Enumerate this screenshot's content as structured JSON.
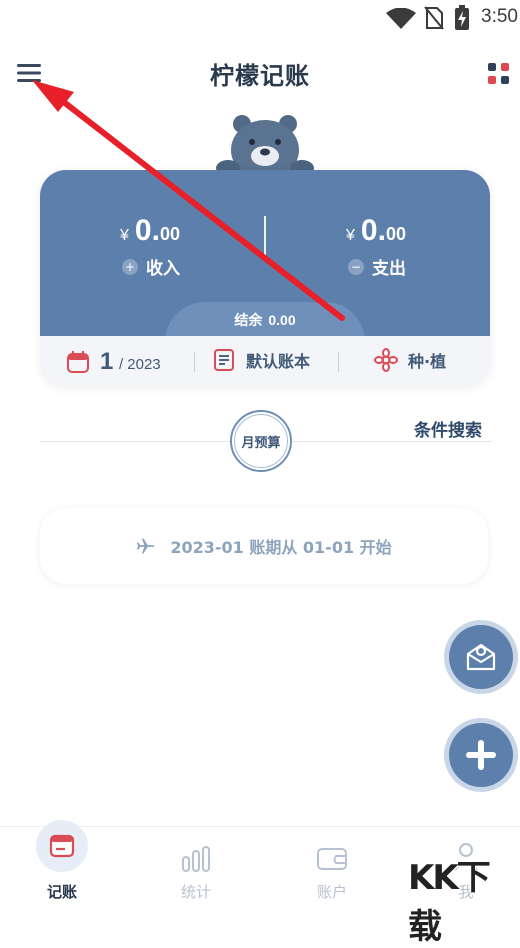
{
  "status_bar": {
    "time": "3:50"
  },
  "header": {
    "title": "柠檬记账"
  },
  "summary_card": {
    "currency": "¥",
    "income_int": "0.",
    "income_dec": "00",
    "income_label": "收入",
    "expense_int": "0.",
    "expense_dec": "00",
    "expense_label": "支出",
    "balance_label": "结余",
    "balance_value": "0.00",
    "month": "1",
    "year": "/ 2023",
    "book_label": "默认账本",
    "plant_label": "种·植"
  },
  "budget": {
    "label": "月预算",
    "search_label": "条件搜索"
  },
  "period": {
    "text": "2023-01 账期从 01-01 开始"
  },
  "bottom_nav": [
    {
      "label": "记账"
    },
    {
      "label": "统计"
    },
    {
      "label": "账户"
    },
    {
      "label": "我"
    }
  ],
  "watermark": {
    "text": "KK下载"
  },
  "colors": {
    "primary": "#5c7fac",
    "arrow": "#e8202a"
  }
}
